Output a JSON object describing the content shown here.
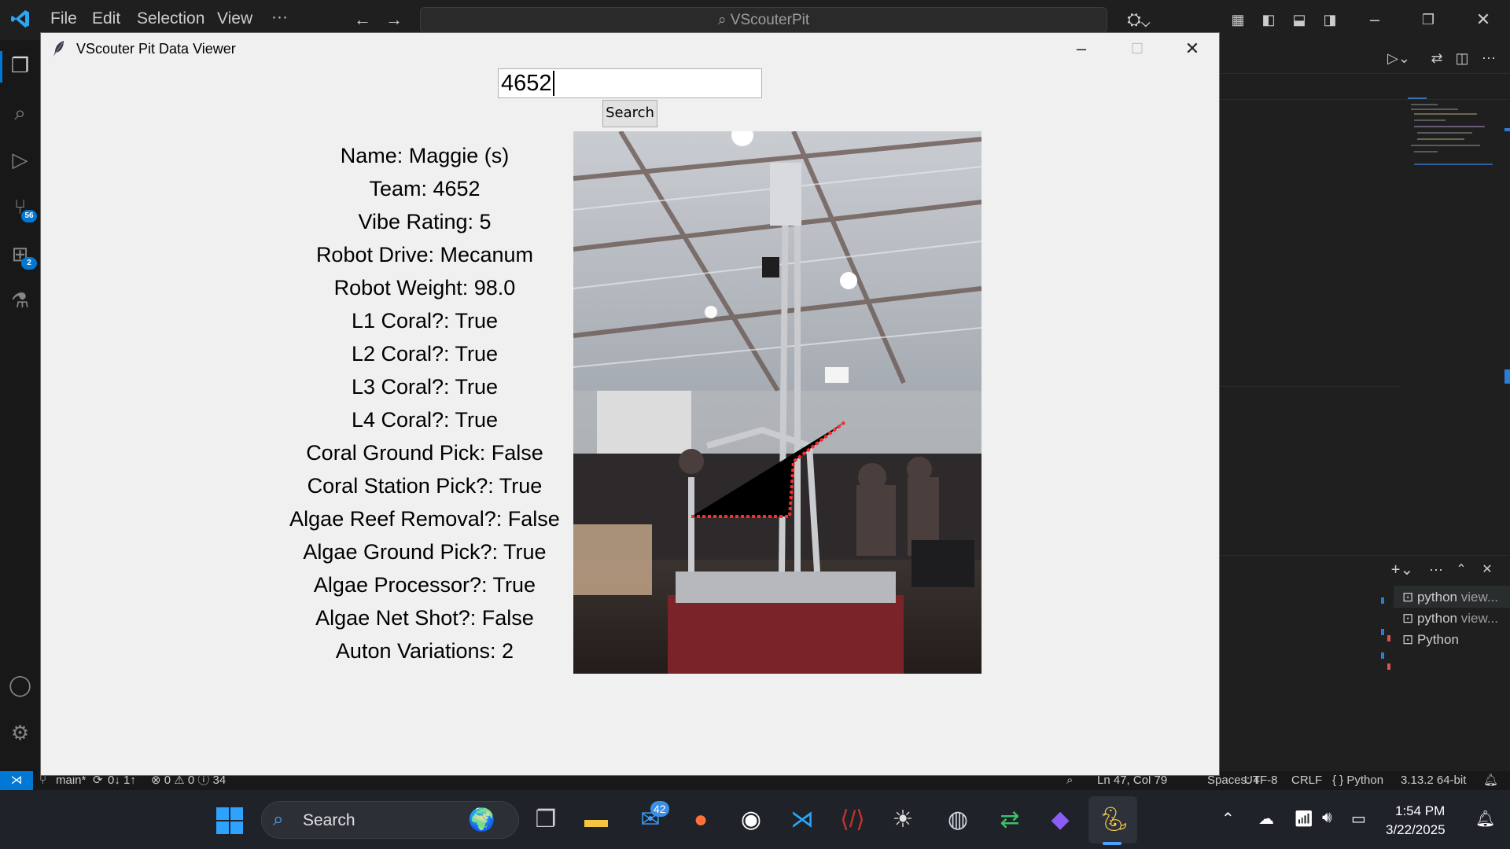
{
  "vscode": {
    "menu": [
      "File",
      "Edit",
      "Selection",
      "View"
    ],
    "more": "···",
    "command_center": "VScouterPit",
    "badges": {
      "source_control": "56",
      "extensions": "2"
    },
    "terminal_tabs": [
      {
        "name": "python",
        "detail": "view..."
      },
      {
        "name": "python",
        "detail": "view..."
      },
      {
        "name": "Python",
        "detail": ""
      }
    ],
    "status": {
      "branch": "main*",
      "sync": "0↓ 1↑",
      "problems": "⊗ 0 ⚠ 0 ⓘ 34",
      "position": "Ln 47, Col 79",
      "spaces": "Spaces: 4",
      "encoding": "UTF-8",
      "eol": "CRLF",
      "language": "{ } Python",
      "interpreter": "3.13.2 64-bit"
    },
    "accent": "#0078d4"
  },
  "window": {
    "title": "VScouter Pit Data Viewer"
  },
  "search": {
    "value": "4652",
    "button_label": "Search"
  },
  "team_info": [
    "Name: Maggie (s)",
    "Team: 4652",
    "Vibe Rating: 5",
    "Robot Drive: Mecanum",
    "Robot Weight: 98.0",
    "L1 Coral?: True",
    "L2 Coral?: True",
    "L3 Coral?: True",
    "L4 Coral?: True",
    "Coral Ground Pick: False",
    "Coral Station Pick?: True",
    "Algae Reef Removal?: False",
    "Algae Ground Pick?: True",
    "Algae Processor?: True",
    "Algae Net Shot?: False",
    "Auton Variations: 2"
  ],
  "taskbar": {
    "search_label": "Search",
    "mail_badge": "42",
    "time": "1:54 PM",
    "date": "3/22/2025"
  }
}
